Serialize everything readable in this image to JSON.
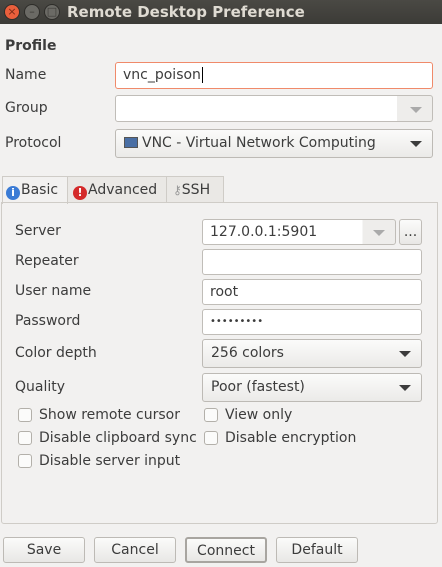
{
  "window": {
    "title": "Remote Desktop Preference"
  },
  "profile": {
    "heading": "Profile",
    "name_label": "Name",
    "name_value": "vnc_poison",
    "group_label": "Group",
    "group_value": "",
    "protocol_label": "Protocol",
    "protocol_value": "VNC - Virtual Network Computing"
  },
  "tabs": [
    {
      "label": "Basic",
      "icon": "info-icon"
    },
    {
      "label": "Advanced",
      "icon": "warning-icon"
    },
    {
      "label": "SSH",
      "icon": "key-icon"
    }
  ],
  "basic": {
    "server_label": "Server",
    "server_value": "127.0.0.1:5901",
    "browse_label": "...",
    "repeater_label": "Repeater",
    "repeater_value": "",
    "username_label": "User name",
    "username_value": "root",
    "password_label": "Password",
    "password_value": "•••••••••",
    "color_depth_label": "Color depth",
    "color_depth_value": "256 colors",
    "quality_label": "Quality",
    "quality_value": "Poor (fastest)",
    "checkboxes": [
      {
        "label": "Show remote cursor",
        "checked": false
      },
      {
        "label": "View only",
        "checked": false
      },
      {
        "label": "Disable clipboard sync",
        "checked": false
      },
      {
        "label": "Disable encryption",
        "checked": false
      },
      {
        "label": "Disable server input",
        "checked": false
      }
    ]
  },
  "buttons": {
    "save": "Save",
    "cancel": "Cancel",
    "connect": "Connect",
    "default": "Default"
  },
  "colors": {
    "titlebar": "#3c3b37",
    "focus_border": "#f08a6a",
    "close": "#e95f3c"
  }
}
